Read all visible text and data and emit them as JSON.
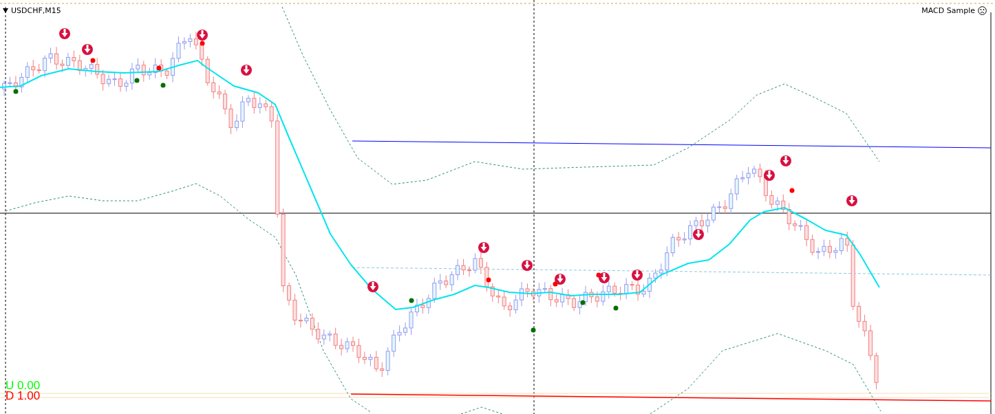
{
  "chart": {
    "symbol_label": "USDCHF,M15"
  },
  "expert": {
    "name": "MACD Sample"
  },
  "indicator_labels": [
    {
      "text": "U 0.00",
      "color": "#00ff00"
    },
    {
      "text": "D 1.00",
      "color": "#ff0000"
    }
  ]
}
